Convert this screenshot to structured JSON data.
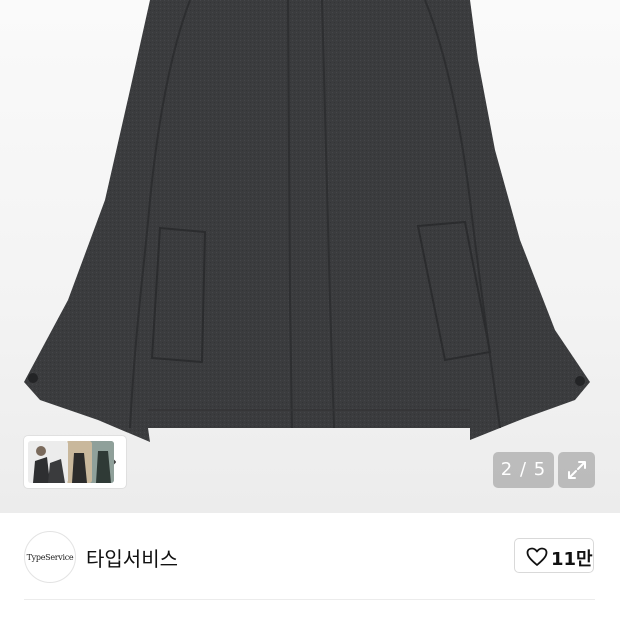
{
  "gallery": {
    "current_index": 2,
    "total": 5,
    "counter_text": "2 / 5",
    "product_color": "#3a3b3d",
    "thumbnails": [
      {
        "icon": "model-photo-thumb"
      },
      {
        "icon": "beige-coat-thumb"
      },
      {
        "icon": "green-coat-thumb"
      }
    ]
  },
  "shop": {
    "logo_text": "TypeService",
    "name": "타입서비스",
    "likes": "11만"
  }
}
